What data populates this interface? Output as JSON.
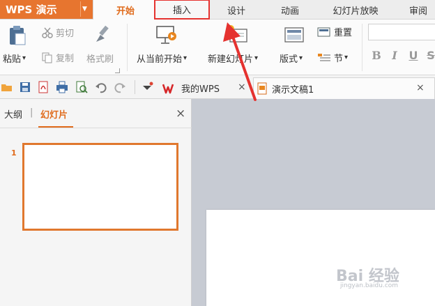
{
  "app": {
    "name": "WPS 演示",
    "caret": "▼",
    "accent": "#e7752f"
  },
  "menu": {
    "tabs": [
      {
        "label": "开始"
      },
      {
        "label": "插入"
      },
      {
        "label": "设计"
      },
      {
        "label": "动画"
      },
      {
        "label": "幻灯片放映"
      },
      {
        "label": "审阅"
      }
    ],
    "active_tab": "开始",
    "highlighted_tab": "插入",
    "highlight_color": "#e5322f"
  },
  "ribbon": {
    "paste": "粘贴",
    "cut": "剪切",
    "copy": "复制",
    "format_painter": "格式刷",
    "from_current": "从当前开始",
    "new_slide": "新建幻灯片",
    "layout": "版式",
    "reset": "重置",
    "section": "节",
    "bold": "B",
    "italic": "I",
    "underline": "U",
    "strike": "S",
    "dropdown_glyph": "▾"
  },
  "quickbar": {
    "icons": [
      "open-folder-icon",
      "save-icon",
      "pdf-icon",
      "print-icon",
      "preview-icon",
      "undo-icon",
      "redo-icon",
      "customize-icon"
    ],
    "tabs": [
      {
        "label": "我的WPS",
        "icon": "wps-logo-icon"
      },
      {
        "label": "演示文稿1",
        "icon": "presentation-file-icon"
      }
    ],
    "close_glyph": "×"
  },
  "left_panel": {
    "tabs": [
      {
        "label": "大纲"
      },
      {
        "label": "幻灯片"
      }
    ],
    "divider": "|",
    "active_tab": "幻灯片",
    "close_glyph": "×",
    "slides": [
      {
        "number": "1"
      }
    ]
  },
  "watermark": {
    "text": "Bai 经验",
    "sub": "jingyan.baidu.com"
  }
}
